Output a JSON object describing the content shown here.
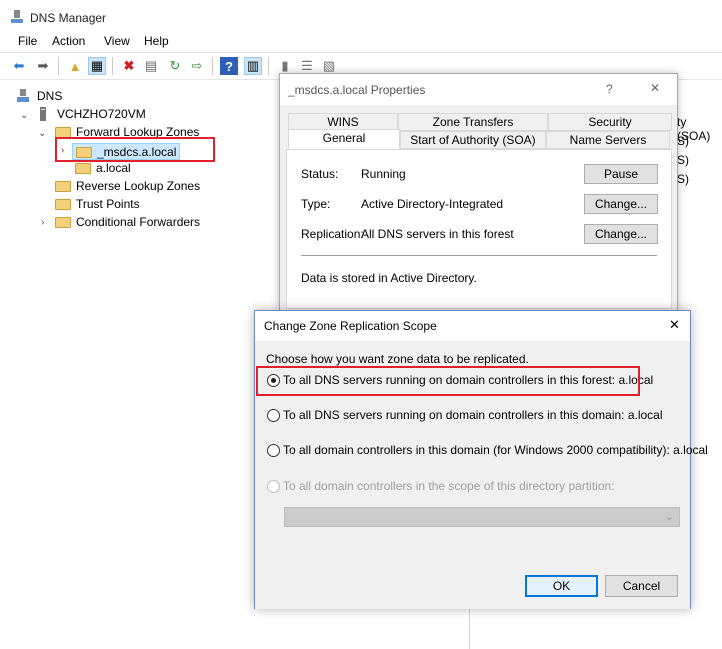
{
  "app": {
    "title": "DNS Manager"
  },
  "menu": [
    "File",
    "Action",
    "View",
    "Help"
  ],
  "tree": {
    "root": "DNS",
    "server": "VCHZHO720VM",
    "forward": "Forward Lookup Zones",
    "zone1": "_msdcs.a.local",
    "zone2": "a.local",
    "reverse": "Reverse Lookup Zones",
    "trust": "Trust Points",
    "conditional": "Conditional Forwarders"
  },
  "right_pane": {
    "col_fragment": "ty (SOA)",
    "rows": [
      "S)",
      "S)",
      "S)"
    ]
  },
  "properties": {
    "title": "_msdcs.a.local Properties",
    "help_glyph": "?",
    "close_glyph": "✕",
    "tabs_top": [
      "WINS",
      "Zone Transfers",
      "Security"
    ],
    "tabs_bottom": [
      "General",
      "Start of Authority (SOA)",
      "Name Servers"
    ],
    "status_label": "Status:",
    "status_value": "Running",
    "pause_btn": "Pause",
    "type_label": "Type:",
    "type_value": "Active Directory-Integrated",
    "change1": "Change...",
    "replication_label": "Replication:",
    "replication_value": "All DNS servers in this forest",
    "change2": "Change...",
    "stored": "Data is stored in Active Directory."
  },
  "change_dialog": {
    "title": "Change Zone Replication Scope",
    "close_glyph": "✕",
    "prompt": "Choose how you want zone data to be replicated.",
    "options": [
      "To all DNS servers running on domain controllers in this forest: a.local",
      "To all DNS servers running on domain controllers in this domain: a.local",
      "To all domain controllers in this domain (for Windows 2000 compatibility): a.local",
      "To all domain controllers in the scope of this directory partition:"
    ],
    "selected_index": 0,
    "ok": "OK",
    "cancel": "Cancel"
  },
  "colors": {
    "highlight": "#e0202a",
    "accent": "#0078d7"
  }
}
